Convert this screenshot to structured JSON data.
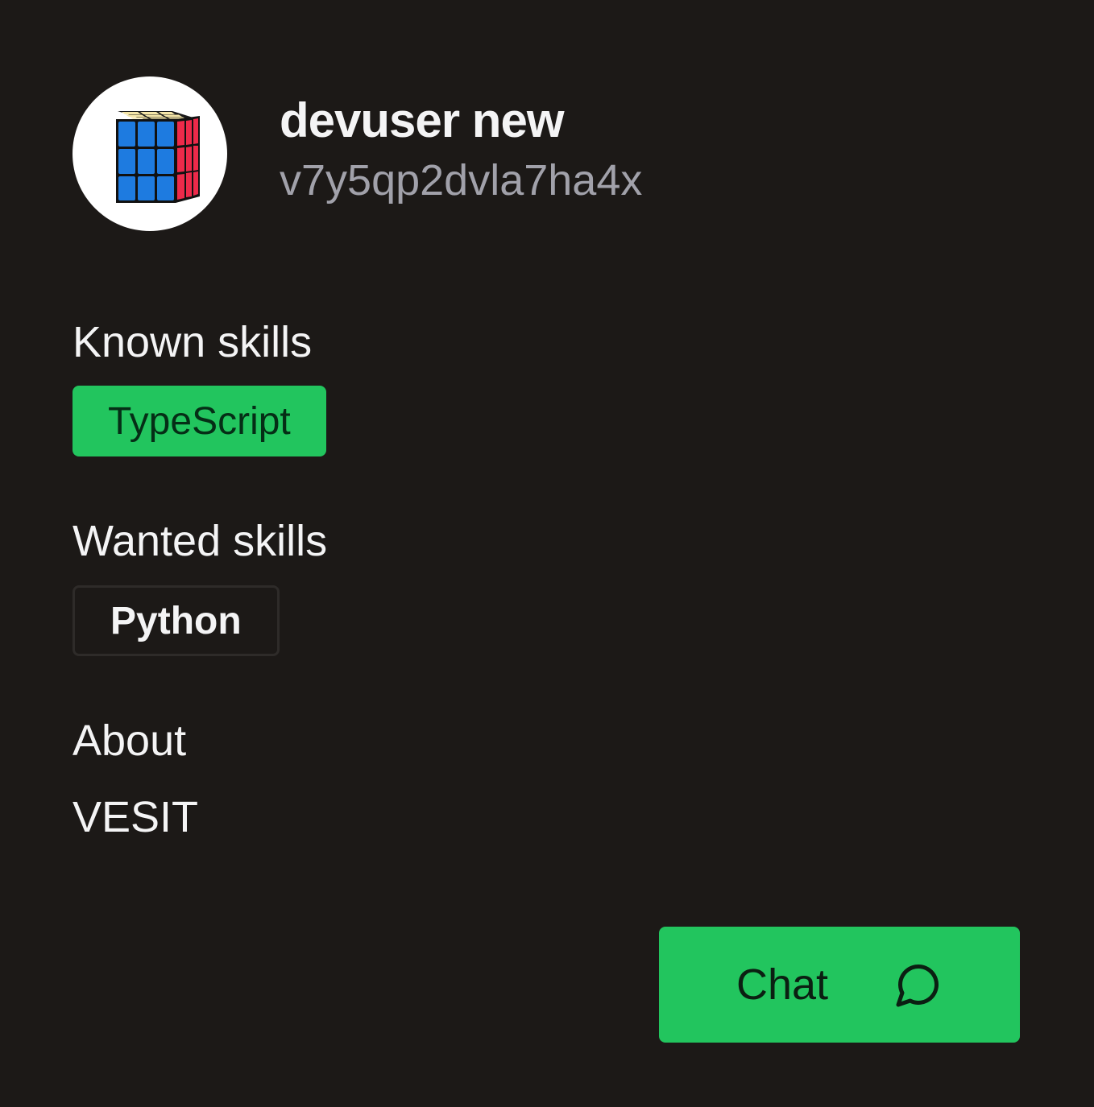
{
  "profile": {
    "display_name": "devuser new",
    "username": "v7y5qp2dvla7ha4x",
    "avatar_icon": "rubiks-cube-icon"
  },
  "known_skills": {
    "title": "Known skills",
    "items": [
      "TypeScript"
    ]
  },
  "wanted_skills": {
    "title": "Wanted skills",
    "items": [
      "Python"
    ]
  },
  "about": {
    "title": "About",
    "text": "VESIT"
  },
  "actions": {
    "chat_label": "Chat",
    "chat_icon": "message-circle-icon"
  },
  "colors": {
    "background": "#1c1917",
    "accent": "#22c55e",
    "muted_text": "#a1a1aa"
  }
}
